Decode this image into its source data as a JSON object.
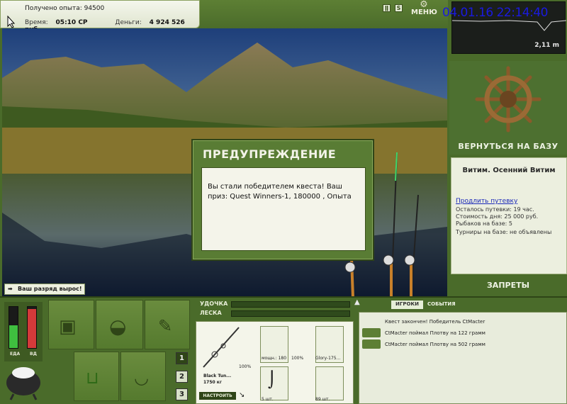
{
  "hud": {
    "exp_label": "Получено опыта: 94500",
    "time_label": "Время:",
    "time_value": "05:10 СР",
    "money_label": "Деньги:",
    "money_value": "4 924 526 руб.",
    "menu": "МЕНЮ",
    "clock": "04.01.16 22:14:40",
    "depth": "2,11 m"
  },
  "side": {
    "return_label": "ВЕРНУТЬСЯ НА БАЗУ",
    "location": "Витим. Осенний Витим",
    "extend_link": "Продлить путевку",
    "stats": [
      "Осталось путевки: 19 час.",
      "Стоимость дня: 25 000 руб.",
      "Рыбаков на базе: 5",
      "Турниры на базе: не объявлены"
    ],
    "bans_label": "ЗАПРЕТЫ"
  },
  "dialog": {
    "title": "ПРЕДУПРЕЖДЕНИЕ",
    "message": "Вы стали победителем квеста! Ваш приз: Quest Winners-1, 180000 , Опыта"
  },
  "rank_text": "Ваш разряд вырос!",
  "meters": {
    "food_label": "ЕДА",
    "water_label": "ВД",
    "food_level": 0.55,
    "water_level": 0.95
  },
  "slots": [
    "1",
    "2",
    "3"
  ],
  "tackle": {
    "rod_label": "УДОЧКА",
    "line_label": "ЛЕСКА",
    "rod_name": "Black Tun...",
    "rod_weight": "1750 кг",
    "rod_pct": "100%",
    "setup_button": "НАСТРОИТЬ",
    "reel_stat": "мощн.: 180",
    "reel_pct": "100%",
    "lure_name": "Glory-175...",
    "hooks_count": "5 шт.",
    "bait_count": "89 шт."
  },
  "events": {
    "tab_players": "ИГРОКИ",
    "tab_events": "СОБЫТИЯ",
    "items": [
      "Квест закончен! Победитель CtMacter",
      "CtMacter поймал Плотву на 122 грамм",
      "CtMacter поймал Плотву на 502 грамм"
    ]
  },
  "colors": {
    "panel_green": "#4a6b2a",
    "clock_blue": "#1a1adf",
    "link_blue": "#1a28b8"
  }
}
